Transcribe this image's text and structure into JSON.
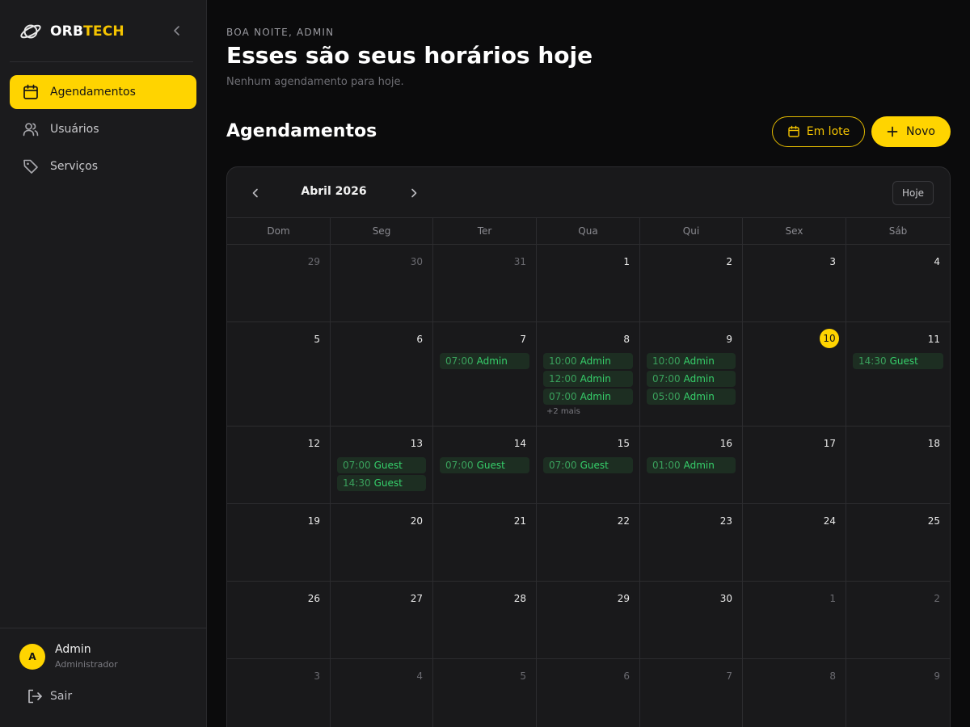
{
  "brand": {
    "part1": "ORB",
    "part2": "TECH"
  },
  "nav": [
    {
      "label": "Agendamentos",
      "icon": "calendar-icon",
      "active": true
    },
    {
      "label": "Usuários",
      "icon": "users-icon",
      "active": false
    },
    {
      "label": "Serviços",
      "icon": "tag-icon",
      "active": false
    }
  ],
  "user": {
    "initial": "A",
    "name": "Admin",
    "role": "Administrador"
  },
  "logout_label": "Sair",
  "header": {
    "greeting": "BOA NOITE, ADMIN",
    "headline": "Esses são seus horários hoje",
    "subline": "Nenhum agendamento para hoje."
  },
  "section": {
    "title": "Agendamentos",
    "batch_label": "Em lote",
    "new_label": "Novo"
  },
  "colors": {
    "accent": "#ffd400",
    "event_bg": "#1d2e22",
    "event_text": "#36d06b"
  },
  "calendar": {
    "month_label": "Abril 2026",
    "today_label": "Hoje",
    "weekdays": [
      "Dom",
      "Seg",
      "Ter",
      "Qua",
      "Qui",
      "Sex",
      "Sáb"
    ],
    "weeks": [
      [
        {
          "day": "29",
          "out": true,
          "events": []
        },
        {
          "day": "30",
          "out": true,
          "events": []
        },
        {
          "day": "31",
          "out": true,
          "events": []
        },
        {
          "day": "1",
          "events": []
        },
        {
          "day": "2",
          "events": []
        },
        {
          "day": "3",
          "events": []
        },
        {
          "day": "4",
          "events": []
        }
      ],
      [
        {
          "day": "5",
          "events": []
        },
        {
          "day": "6",
          "events": []
        },
        {
          "day": "7",
          "events": [
            {
              "time": "07:00",
              "who": "Admin"
            }
          ]
        },
        {
          "day": "8",
          "events": [
            {
              "time": "10:00",
              "who": "Admin"
            },
            {
              "time": "12:00",
              "who": "Admin"
            },
            {
              "time": "07:00",
              "who": "Admin"
            }
          ],
          "more": "+2 mais"
        },
        {
          "day": "9",
          "events": [
            {
              "time": "10:00",
              "who": "Admin"
            },
            {
              "time": "07:00",
              "who": "Admin"
            },
            {
              "time": "05:00",
              "who": "Admin"
            }
          ]
        },
        {
          "day": "10",
          "today": true,
          "events": []
        },
        {
          "day": "11",
          "events": [
            {
              "time": "14:30",
              "who": "Guest"
            }
          ]
        }
      ],
      [
        {
          "day": "12",
          "events": []
        },
        {
          "day": "13",
          "events": [
            {
              "time": "07:00",
              "who": "Guest"
            },
            {
              "time": "14:30",
              "who": "Guest"
            }
          ]
        },
        {
          "day": "14",
          "events": [
            {
              "time": "07:00",
              "who": "Guest"
            }
          ]
        },
        {
          "day": "15",
          "events": [
            {
              "time": "07:00",
              "who": "Guest"
            }
          ]
        },
        {
          "day": "16",
          "events": [
            {
              "time": "01:00",
              "who": "Admin"
            }
          ]
        },
        {
          "day": "17",
          "events": []
        },
        {
          "day": "18",
          "events": []
        }
      ],
      [
        {
          "day": "19",
          "events": []
        },
        {
          "day": "20",
          "events": []
        },
        {
          "day": "21",
          "events": []
        },
        {
          "day": "22",
          "events": []
        },
        {
          "day": "23",
          "events": []
        },
        {
          "day": "24",
          "events": []
        },
        {
          "day": "25",
          "events": []
        }
      ],
      [
        {
          "day": "26",
          "events": []
        },
        {
          "day": "27",
          "events": []
        },
        {
          "day": "28",
          "events": []
        },
        {
          "day": "29",
          "events": []
        },
        {
          "day": "30",
          "events": []
        },
        {
          "day": "1",
          "out": true,
          "events": []
        },
        {
          "day": "2",
          "out": true,
          "events": []
        }
      ],
      [
        {
          "day": "3",
          "out": true,
          "events": []
        },
        {
          "day": "4",
          "out": true,
          "events": []
        },
        {
          "day": "5",
          "out": true,
          "events": []
        },
        {
          "day": "6",
          "out": true,
          "events": []
        },
        {
          "day": "7",
          "out": true,
          "events": []
        },
        {
          "day": "8",
          "out": true,
          "events": []
        },
        {
          "day": "9",
          "out": true,
          "events": []
        }
      ]
    ]
  }
}
